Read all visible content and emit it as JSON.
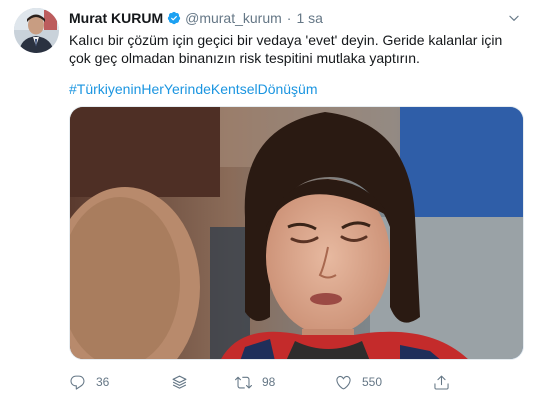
{
  "tweet": {
    "author_name": "Murat KURUM",
    "handle": "@murat_kurum",
    "separator": "·",
    "time": "1 sa",
    "text": "Kalıcı bir çözüm için geçici bir vedaya 'evet' deyin. Geride kalanlar için çok geç olmadan binanızın risk tespitini mutlaka yaptırın.",
    "hashtag": "#TürkiyeninHerYerindeKentselDönüşüm",
    "verified_color": "#1da1f2",
    "link_color": "#1b95e0"
  },
  "actions": {
    "reply_count": "36",
    "retweet_count": "98",
    "like_count": "550"
  },
  "icons": [
    "verified-badge-icon",
    "chevron-down-icon",
    "reply-icon",
    "stack-icon",
    "retweet-icon",
    "like-icon",
    "share-icon"
  ]
}
